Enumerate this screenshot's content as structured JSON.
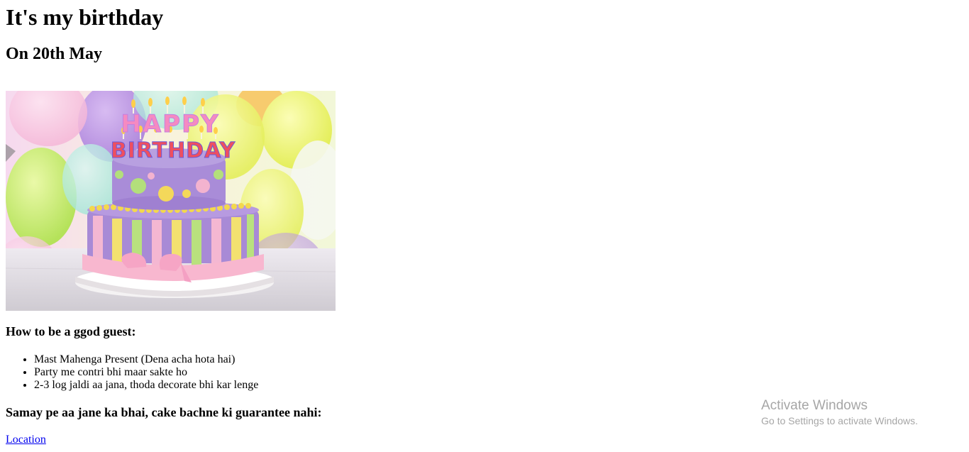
{
  "heading": "It's my birthday",
  "date": "On 20th May",
  "image": {
    "banner_text_line1": "HAPPY",
    "banner_text_line2": "BIRTHDAY"
  },
  "guest_heading": "How to be a ggod guest:",
  "tips": [
    "Mast Mahenga Present (Dena acha hota hai)",
    "Party me contri bhi maar sakte ho",
    "2-3 log jaldi aa jana, thoda decorate bhi kar lenge"
  ],
  "warning": "Samay pe aa jane ka bhai, cake bachne ki guarantee nahi:",
  "link_label": "Location",
  "watermark": {
    "title": "Activate Windows",
    "subtitle": "Go to Settings to activate Windows."
  }
}
